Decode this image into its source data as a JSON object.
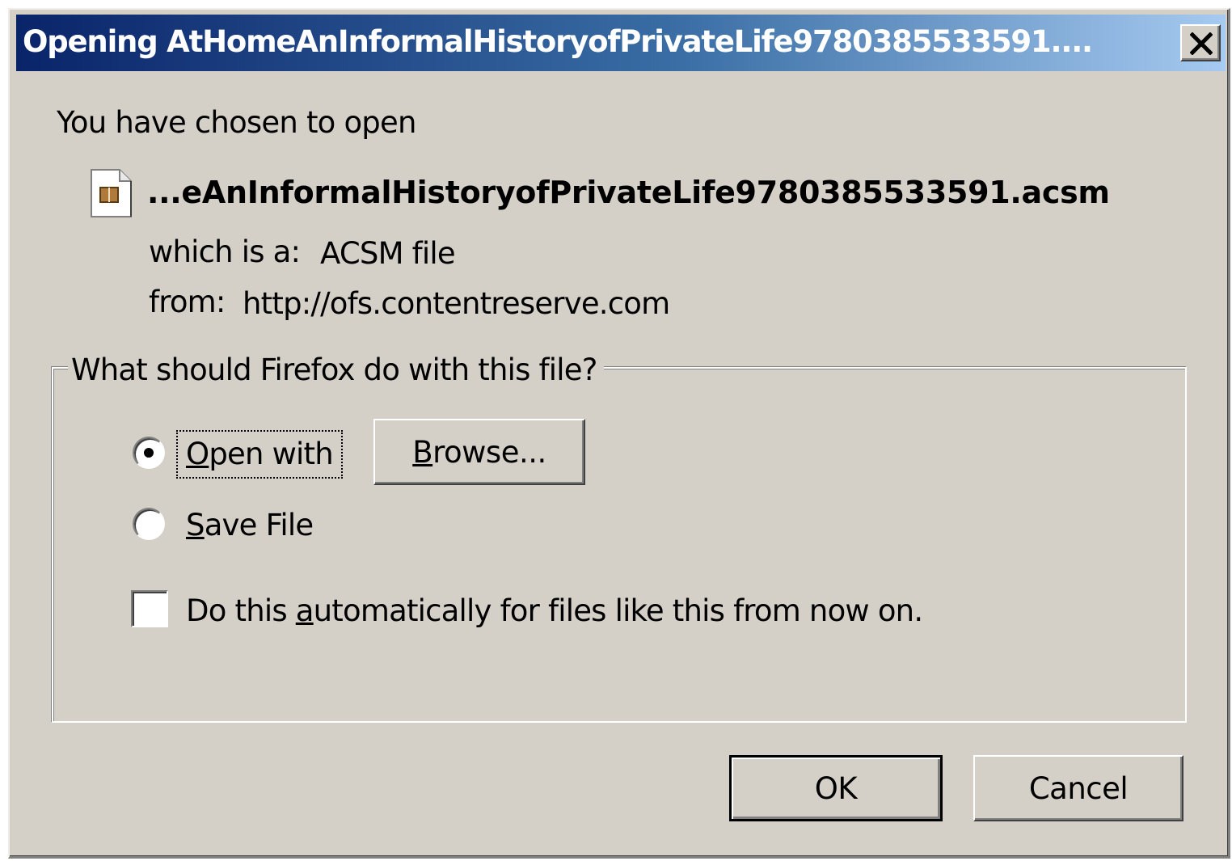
{
  "window": {
    "title": "Opening AtHomeAnInformalHistoryofPrivateLife9780385533591....",
    "close_glyph": "✕"
  },
  "intro": {
    "chosen_text": "You have chosen to open",
    "file_name": "...eAnInformalHistoryofPrivateLife9780385533591.acsm",
    "type_label": "which is a:",
    "type_value": "ACSM file",
    "from_label": "from:",
    "from_value": "http://ofs.contentreserve.com"
  },
  "action_group": {
    "legend": "What should Firefox do with this file?",
    "open_with": {
      "label": "Open with",
      "selected": true
    },
    "browse_label": "Browse...",
    "save_file": {
      "label": "Save File",
      "selected": false
    },
    "auto_checkbox": {
      "label": "Do this automatically for files like this from now on.",
      "checked": false
    }
  },
  "footer": {
    "ok_label": "OK",
    "cancel_label": "Cancel"
  },
  "icons": {
    "file": "file-icon",
    "close": "close-icon"
  },
  "colors": {
    "title_gradient_start": "#0a246a",
    "title_gradient_end": "#a6caf0",
    "dialog_face": "#d4d0c8"
  }
}
